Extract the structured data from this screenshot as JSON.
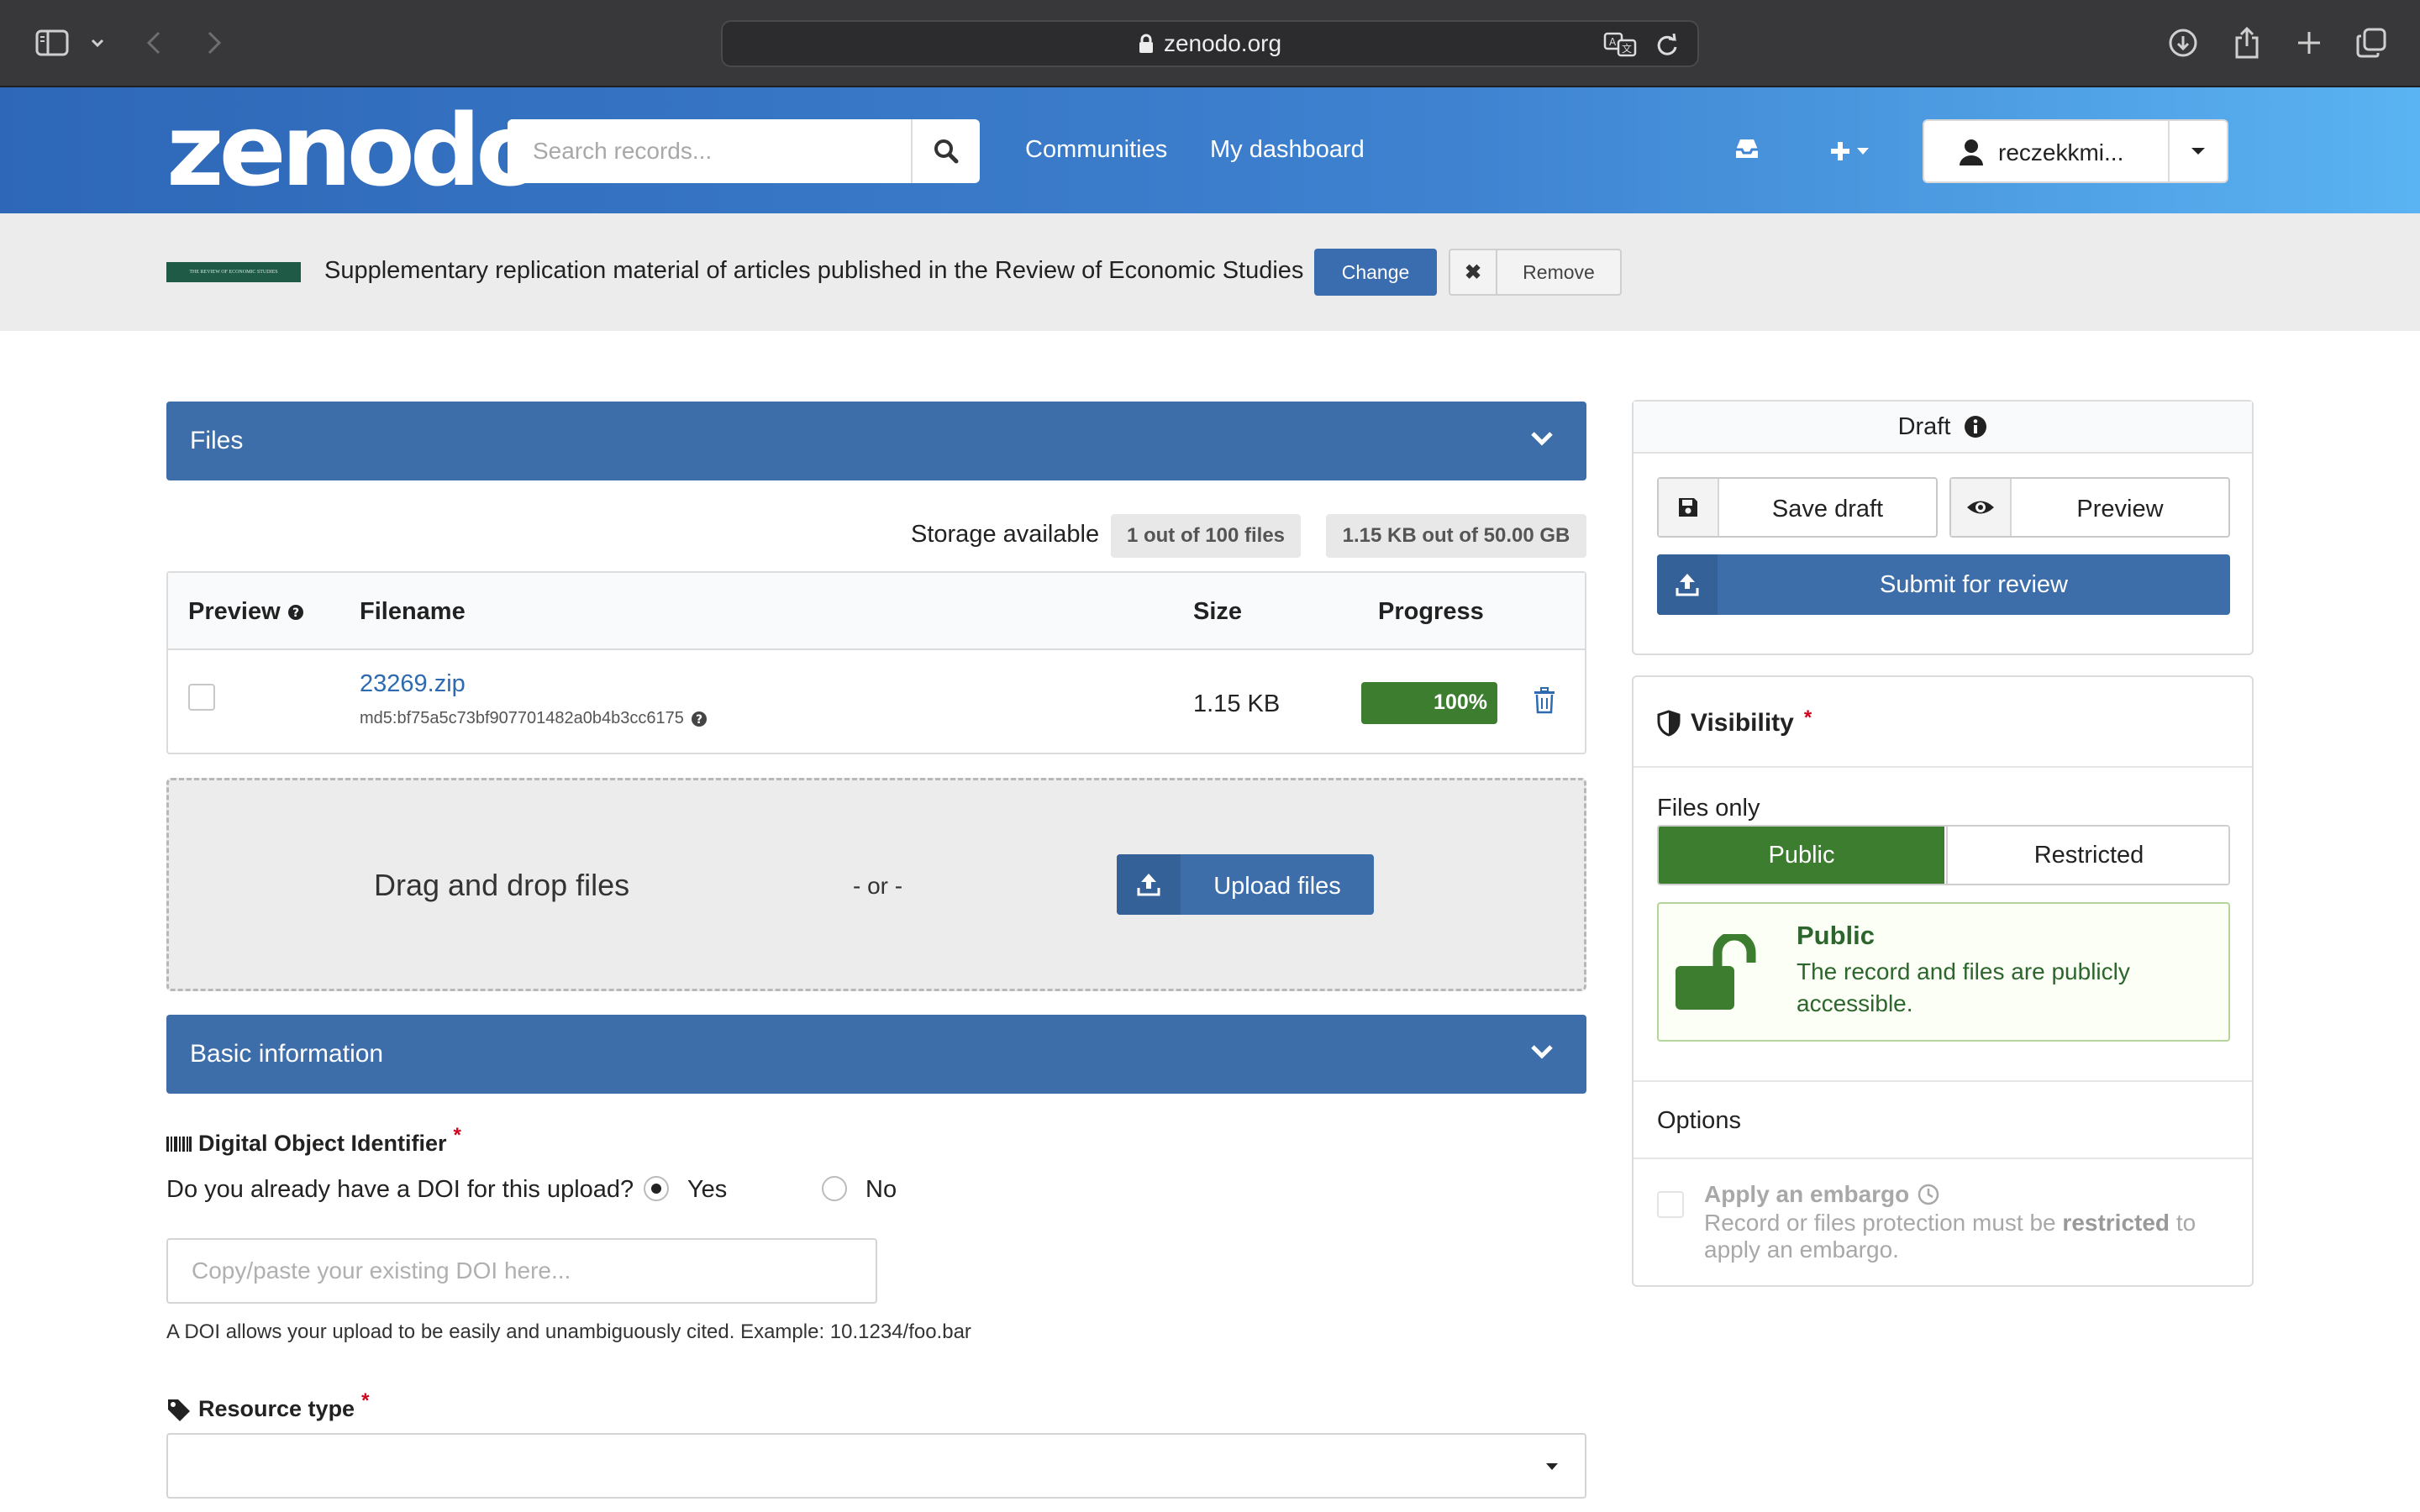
{
  "browser": {
    "url": "zenodo.org"
  },
  "header": {
    "logo": "zenodo",
    "search_placeholder": "Search records...",
    "nav": [
      "Communities",
      "My dashboard"
    ],
    "user": "reczekkmi..."
  },
  "community": {
    "logo_text": "THE REVIEW OF ECONOMIC STUDIES",
    "title": "Supplementary replication material of articles published in the Review of Economic Studies",
    "change_label": "Change",
    "remove_label": "Remove"
  },
  "files": {
    "section_title": "Files",
    "storage_label": "Storage available",
    "files_badge": "1 out of 100 files",
    "size_badge": "1.15 KB out of 50.00 GB",
    "columns": [
      "Preview",
      "Filename",
      "Size",
      "Progress"
    ],
    "rows": [
      {
        "filename": "23269.zip",
        "md5": "md5:bf75a5c73bf907701482a0b4b3cc6175",
        "size": "1.15 KB",
        "progress": "100%",
        "progress_value": 1.0
      }
    ],
    "drag_text": "Drag and drop files",
    "or_text": "- or -",
    "upload_label": "Upload files"
  },
  "basic_info": {
    "section_title": "Basic information",
    "doi_label": "Digital Object Identifier",
    "doi_required": "*",
    "doi_question": "Do you already have a DOI for this upload?",
    "yes_label": "Yes",
    "no_label": "No",
    "doi_selected": "Yes",
    "doi_placeholder": "Copy/paste your existing DOI here...",
    "doi_help": "A DOI allows your upload to be easily and unambiguously cited. Example: 10.1234/foo.bar",
    "resource_label": "Resource type",
    "resource_required": "*",
    "resource_value": ""
  },
  "sidebar": {
    "status": "Draft",
    "save_draft": "Save draft",
    "preview": "Preview",
    "submit": "Submit for review",
    "visibility_title": "Visibility",
    "visibility_required": "*",
    "files_only": "Files only",
    "public_label": "Public",
    "restricted_label": "Restricted",
    "public_msg_title": "Public",
    "public_msg_body": "The record and files are publicly accessible.",
    "options_label": "Options",
    "embargo_title": "Apply an embargo",
    "embargo_desc_1": "Record or files protection must be",
    "embargo_desc_bold": "restricted",
    "embargo_desc_2": "to apply an embargo."
  },
  "colors": {
    "primary": "#3e6ea9",
    "success": "#3c7d2f",
    "link": "#2d6ab0"
  }
}
